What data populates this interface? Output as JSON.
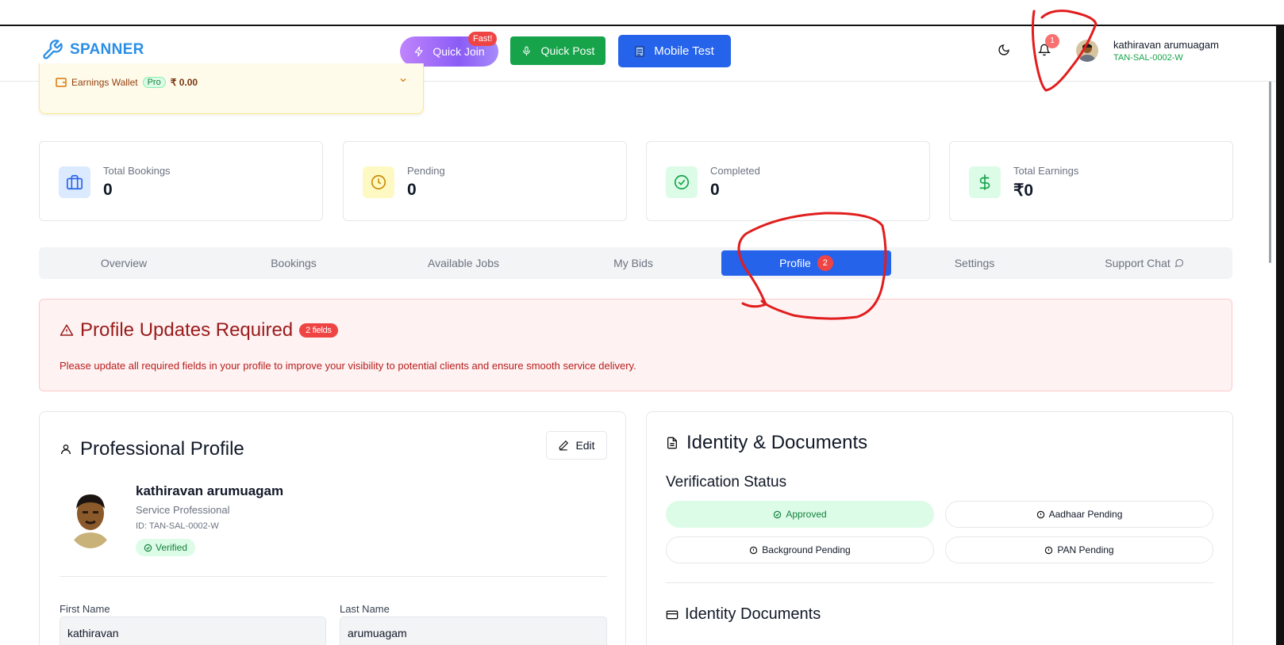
{
  "header": {
    "brand": "SPANNER",
    "quick_join": "Quick Join",
    "fast_badge": "Fast!",
    "quick_post": "Quick Post",
    "mobile_test": "Mobile Test",
    "notification_count": "1",
    "user_name": "kathiravan arumuagam",
    "user_id": "TAN-SAL-0002-W"
  },
  "wallet": {
    "label": "Earnings Wallet",
    "pro": "Pro",
    "amount": "₹ 0.00"
  },
  "stats": [
    {
      "label": "Total Bookings",
      "value": "0",
      "icon": "briefcase-icon"
    },
    {
      "label": "Pending",
      "value": "0",
      "icon": "clock-icon"
    },
    {
      "label": "Completed",
      "value": "0",
      "icon": "check-circle-icon"
    },
    {
      "label": "Total Earnings",
      "value": "₹0",
      "icon": "dollar-icon"
    }
  ],
  "tabs": [
    {
      "label": "Overview"
    },
    {
      "label": "Bookings"
    },
    {
      "label": "Available Jobs"
    },
    {
      "label": "My Bids"
    },
    {
      "label": "Profile",
      "badge": "2",
      "active": true
    },
    {
      "label": "Settings"
    },
    {
      "label": "Support Chat"
    }
  ],
  "alert": {
    "title": "Profile Updates Required",
    "badge": "2 fields",
    "description": "Please update all required fields in your profile to improve your visibility to potential clients and ensure smooth service delivery."
  },
  "profile": {
    "title": "Professional Profile",
    "edit": "Edit",
    "name": "kathiravan arumuagam",
    "role": "Service Professional",
    "id": "ID: TAN-SAL-0002-W",
    "verified": "Verified",
    "first_name_label": "First Name",
    "first_name": "kathiravan",
    "last_name_label": "Last Name",
    "last_name": "arumuagam"
  },
  "identity": {
    "title": "Identity & Documents",
    "verification_title": "Verification Status",
    "statuses": [
      {
        "label": "Approved",
        "state": "approved"
      },
      {
        "label": "Aadhaar Pending",
        "state": "pending"
      },
      {
        "label": "Background Pending",
        "state": "pending"
      },
      {
        "label": "PAN Pending",
        "state": "pending"
      }
    ],
    "documents_title": "Identity Documents"
  },
  "colors": {
    "brand": "#2b8ee6",
    "primary": "#2563eb",
    "success": "#16a34a",
    "danger": "#ef4444",
    "annotation": "#e11d1d"
  }
}
